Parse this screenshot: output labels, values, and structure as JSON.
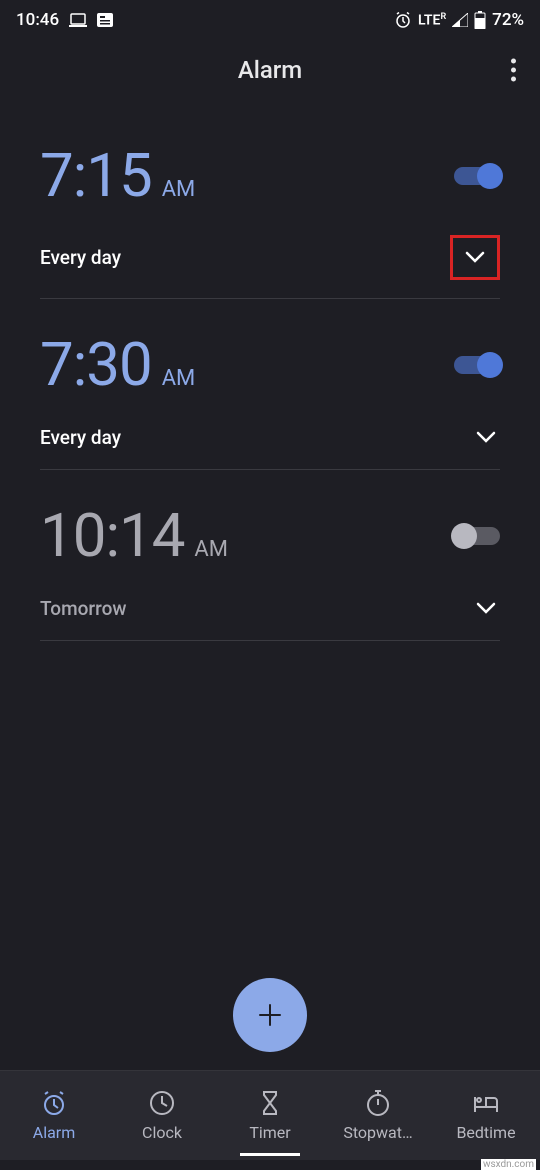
{
  "statusBar": {
    "time": "10:46",
    "network": "LTE",
    "networkSuper": "R",
    "battery": "72%"
  },
  "header": {
    "title": "Alarm"
  },
  "alarms": [
    {
      "time": "7:15",
      "ampm": "AM",
      "enabled": true,
      "schedule": "Every day",
      "highlighted": true
    },
    {
      "time": "7:30",
      "ampm": "AM",
      "enabled": true,
      "schedule": "Every day",
      "highlighted": false
    },
    {
      "time": "10:14",
      "ampm": "AM",
      "enabled": false,
      "schedule": "Tomorrow",
      "highlighted": false
    }
  ],
  "navigation": {
    "items": [
      {
        "label": "Alarm",
        "active": true
      },
      {
        "label": "Clock",
        "active": false
      },
      {
        "label": "Timer",
        "active": false
      },
      {
        "label": "Stopwat…",
        "active": false
      },
      {
        "label": "Bedtime",
        "active": false
      }
    ]
  },
  "watermark": "wsxdn.com"
}
